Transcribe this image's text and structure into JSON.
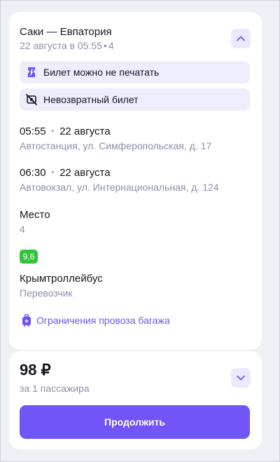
{
  "trip": {
    "route_title": "Саки — Евпатория",
    "date_time": "22 августа в 05:55",
    "seat_short": "4",
    "features": [
      {
        "icon": "ticket-icon",
        "label": "Билет можно не печатать"
      },
      {
        "icon": "no-refund-icon",
        "label": "Невозвратный билет"
      }
    ],
    "departure": {
      "time": "05:55",
      "date": "22 августа",
      "address": "Автостанция, ул. Симферопольская, д. 17"
    },
    "arrival": {
      "time": "06:30",
      "date": "22 августа",
      "address": "Автовокзал, ул. Интернациональная, д. 124"
    },
    "seat": {
      "label": "Место",
      "value": "4"
    },
    "carrier": {
      "rating": "9,6",
      "name": "Крымтроллейбус",
      "role": "Перевозчик"
    },
    "baggage_link": "Ограничения провоза багажа"
  },
  "price": {
    "amount": "98 ₽",
    "per": "за 1 пассажира",
    "continue_label": "Продолжить"
  },
  "colors": {
    "accent": "#7155f6",
    "link": "#6a55f0",
    "pill_bg": "#eeedfc",
    "rating_bg": "#35c23c",
    "muted_text": "#8a8faa"
  }
}
